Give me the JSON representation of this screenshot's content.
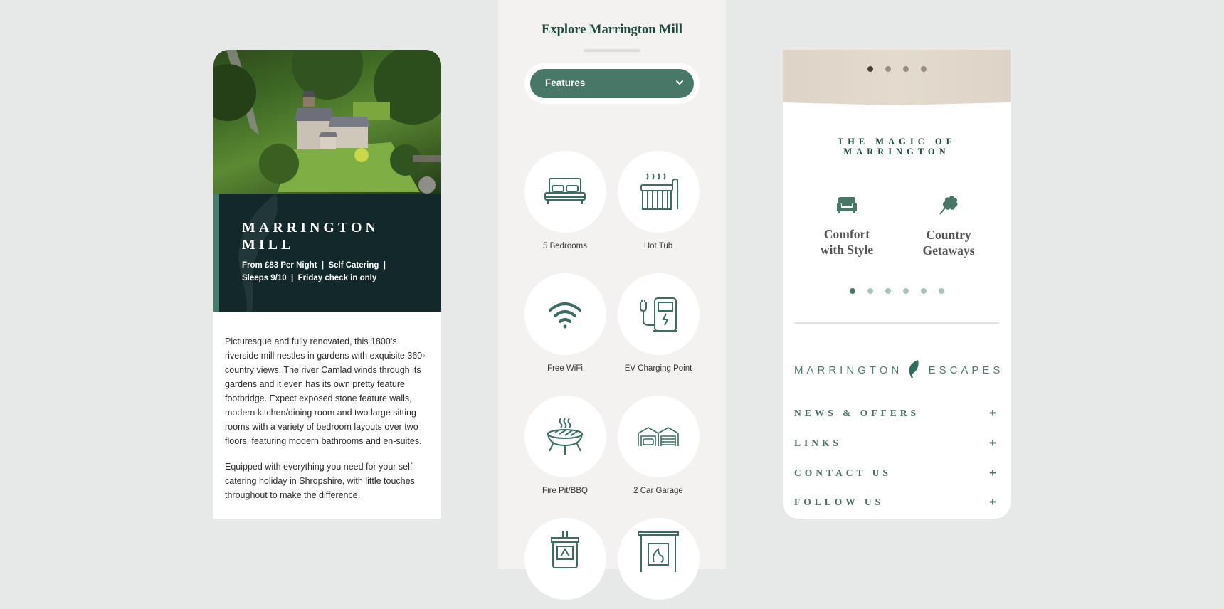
{
  "property_card": {
    "title": "MARRINGTON MILL",
    "meta_line1": "From £83 Per Night  |  Self Catering  |",
    "meta_line2": "Sleeps 9/10  |  Friday check in only",
    "paragraphs": [
      "Picturesque and fully renovated, this 1800’s riverside mill nestles in gardens with exquisite 360◦ country views. The river Camlad winds through its gardens and it even has its own pretty feature footbridge. Expect exposed stone feature walls, modern kitchen/dining room and two large sitting rooms with a variety of bedroom layouts over two floors, featuring modern bathrooms and en-suites.",
      "Equipped with everything you need for your self catering holiday in Shropshire, with little touches throughout to make the difference."
    ]
  },
  "explore": {
    "title": "Explore Marrington Mill",
    "dropdown": {
      "selected": "Features",
      "icon": "chevron-down-icon"
    },
    "features": [
      {
        "label": "5 Bedrooms",
        "icon": "bed-icon"
      },
      {
        "label": "Hot Tub",
        "icon": "hot-tub-icon"
      },
      {
        "label": "Free WiFi",
        "icon": "wifi-icon"
      },
      {
        "label": "EV Charging Point",
        "icon": "ev-charger-icon"
      },
      {
        "label": "Fire Pit/BBQ",
        "icon": "bbq-icon"
      },
      {
        "label": "2 Car Garage",
        "icon": "garage-icon"
      },
      {
        "label": "",
        "icon": "wood-stove-icon"
      },
      {
        "label": "",
        "icon": "fireplace-icon"
      }
    ]
  },
  "footer_card": {
    "hero_carousel": {
      "slides": 4,
      "active": 1
    },
    "heading": "THE MAGIC OF MARRINGTON",
    "perks": [
      {
        "line1": "Comfort",
        "line2": "with Style",
        "icon": "armchair-icon"
      },
      {
        "line1": "Country",
        "line2": "Getaways",
        "icon": "oak-leaf-icon"
      }
    ],
    "perk_carousel": {
      "slides": 6,
      "active": 1
    },
    "logo": {
      "left": "MARRINGTON",
      "right": "ESCAPES",
      "icon": "leaf-icon"
    },
    "accordion": [
      {
        "label": "NEWS & OFFERS",
        "icon": "plus-icon"
      },
      {
        "label": "LINKS",
        "icon": "plus-icon"
      },
      {
        "label": "CONTACT US",
        "icon": "plus-icon"
      },
      {
        "label": "FOLLOW US",
        "icon": "plus-icon"
      }
    ]
  },
  "colors": {
    "brand_green": "#477767",
    "dark": "#12282a",
    "heading_green": "#1f4a40",
    "beige": "#ddd3c6",
    "background": "#e6e9e8"
  }
}
